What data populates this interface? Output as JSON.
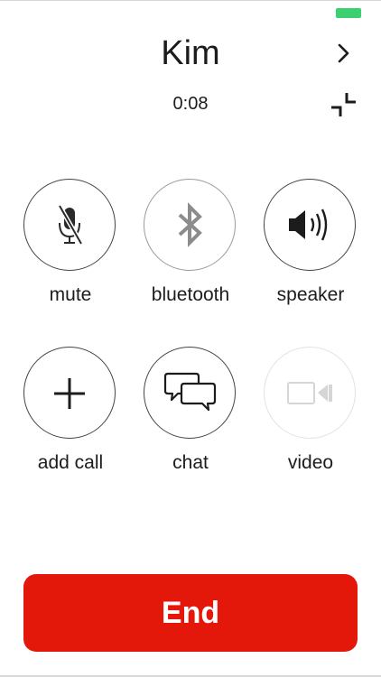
{
  "call": {
    "contact_name": "Kim",
    "duration": "0:08"
  },
  "controls": {
    "mute": "mute",
    "bluetooth": "bluetooth",
    "speaker": "speaker",
    "add_call": "add call",
    "chat": "chat",
    "video": "video"
  },
  "end_label": "End",
  "colors": {
    "end_button": "#e3180b",
    "battery": "#3cd070",
    "disabled": "#d9d9d9"
  },
  "icons": [
    "chevron-right-icon",
    "minimize-icon",
    "microphone-off-icon",
    "bluetooth-icon",
    "speaker-icon",
    "plus-icon",
    "chat-bubbles-icon",
    "video-camera-icon",
    "battery-icon"
  ]
}
